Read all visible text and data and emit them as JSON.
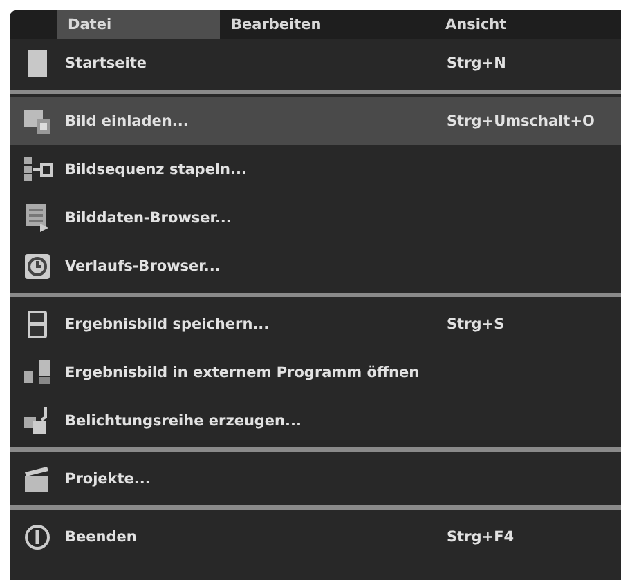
{
  "menubar": [
    {
      "label": "Datei",
      "selected": true
    },
    {
      "label": "Bearbeiten",
      "selected": false
    },
    {
      "label": "Ansicht",
      "selected": false
    }
  ],
  "menu": {
    "groups": [
      {
        "items": [
          {
            "label": "Startseite",
            "shortcut": "Strg+N",
            "selected": false
          }
        ]
      },
      {
        "items": [
          {
            "label": "Bild einladen...",
            "shortcut": "Strg+Umschalt+O",
            "selected": true
          },
          {
            "label": "Bildsequenz stapeln...",
            "selected": false
          },
          {
            "label": "Bilddaten-Browser...",
            "selected": false
          },
          {
            "label": "Verlaufs-Browser...",
            "selected": false
          }
        ]
      },
      {
        "items": [
          {
            "label": "Ergebnisbild speichern...",
            "shortcut": "Strg+S",
            "selected": false
          },
          {
            "label": "Ergebnisbild in externem Programm öffnen",
            "selected": false
          },
          {
            "label": "Belichtungsreihe erzeugen...",
            "selected": false
          }
        ]
      },
      {
        "items": [
          {
            "label": "Projekte...",
            "selected": false
          }
        ]
      },
      {
        "items": [
          {
            "label": "Beenden",
            "shortcut": "Strg+F4",
            "selected": false
          }
        ]
      }
    ]
  }
}
